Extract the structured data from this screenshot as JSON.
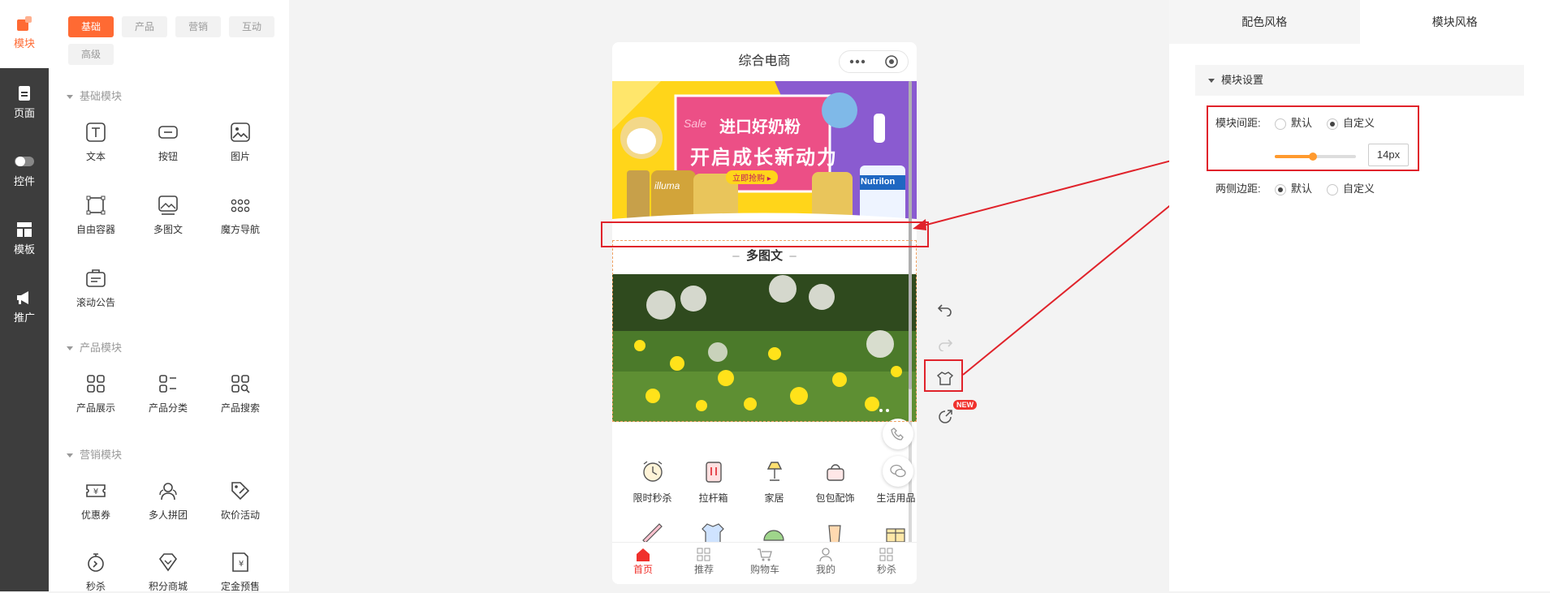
{
  "rail": {
    "items": [
      {
        "label": "模块",
        "icon": "blocks-icon"
      },
      {
        "label": "页面",
        "icon": "page-icon"
      },
      {
        "label": "控件",
        "icon": "toggle-icon"
      },
      {
        "label": "模板",
        "icon": "template-icon"
      },
      {
        "label": "推广",
        "icon": "megaphone-icon"
      }
    ]
  },
  "panel": {
    "tabs": [
      "基础",
      "产品",
      "营销",
      "互动",
      "高级"
    ],
    "sections": [
      {
        "title": "基础模块",
        "modules": [
          "文本",
          "按钮",
          "图片",
          "自由容器",
          "多图文",
          "魔方导航",
          "滚动公告"
        ]
      },
      {
        "title": "产品模块",
        "modules": [
          "产品展示",
          "产品分类",
          "产品搜索"
        ]
      },
      {
        "title": "营销模块",
        "modules": [
          "优惠券",
          "多人拼团",
          "砍价活动",
          "秒杀",
          "积分商城",
          "定金预售"
        ]
      }
    ]
  },
  "phone": {
    "title": "综合电商",
    "banner": {
      "line1": "进口好奶粉",
      "line2": "开启成长新动力",
      "sale": "Sale",
      "cta": "立即抢购 ▸",
      "brand_left": "illuma",
      "brand_right": "Nutrilon"
    },
    "multi_title": "多图文",
    "categories": [
      "限时秒杀",
      "拉杆箱",
      "家居",
      "包包配饰",
      "生活用品"
    ],
    "nav": [
      "首页",
      "推荐",
      "购物车",
      "我的",
      "秒杀"
    ]
  },
  "toolbar": {
    "new_badge": "NEW"
  },
  "settings": {
    "tabs": [
      "配色风格",
      "模块风格"
    ],
    "section": "模块设置",
    "spacing_label": "模块间距:",
    "side_label": "两侧边距:",
    "opt_default": "默认",
    "opt_custom": "自定义",
    "spacing_value": "14px",
    "slider_fraction": 0.47
  },
  "colors": {
    "accent": "#ff6a33",
    "annotation": "#e0232b",
    "rail": "#3d3d3d",
    "nav_active": "#f0312c"
  }
}
